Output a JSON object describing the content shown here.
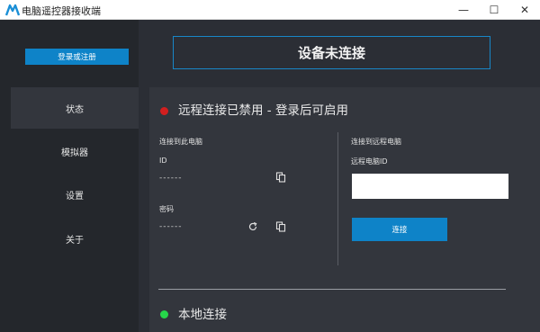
{
  "window": {
    "title": "电脑遥控器接收端",
    "logo_icon": "app-logo-icon",
    "minimize_glyph": "—",
    "maximize_glyph": "☐",
    "close_glyph": "✕"
  },
  "sidebar": {
    "login_button": "登录或注册",
    "items": [
      {
        "label": "状态",
        "active": true
      },
      {
        "label": "模拟器",
        "active": false
      },
      {
        "label": "设置",
        "active": false
      },
      {
        "label": "关于",
        "active": false
      }
    ]
  },
  "main": {
    "connection_banner": "设备未连接",
    "remote_status": "远程连接已禁用 - 登录后可启用",
    "this_pc": {
      "section_label": "连接到此电脑",
      "id_label": "ID",
      "id_value": "------",
      "password_label": "密码",
      "password_value": "------"
    },
    "remote_pc": {
      "section_label": "连接到远程电脑",
      "id_label": "远程电脑ID",
      "id_value": "",
      "connect_button": "连接"
    },
    "local_connection_title": "本地连接"
  },
  "colors": {
    "accent": "#0e83c8",
    "status_disabled": "#d21f1f",
    "status_enabled": "#26d64a"
  }
}
